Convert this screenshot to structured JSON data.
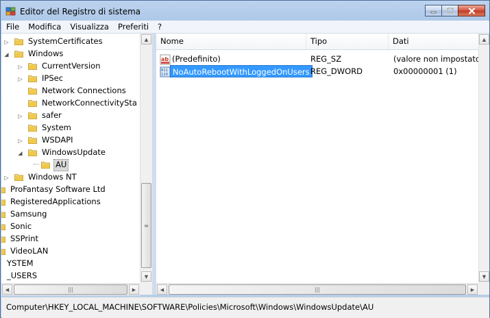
{
  "window": {
    "title": "Editor del Registro di sistema"
  },
  "menu": [
    "File",
    "Modifica",
    "Visualizza",
    "Preferiti",
    "?"
  ],
  "tree": {
    "items": [
      {
        "label": "SystemCertificates",
        "expander": "collapsed"
      },
      {
        "label": "Windows",
        "expander": "expanded"
      },
      {
        "label": "CurrentVersion",
        "expander": "collapsed"
      },
      {
        "label": "IPSec",
        "expander": "collapsed"
      },
      {
        "label": "Network Connections",
        "expander": "none"
      },
      {
        "label": "NetworkConnectivitySta",
        "expander": "none"
      },
      {
        "label": "safer",
        "expander": "collapsed"
      },
      {
        "label": "System",
        "expander": "none"
      },
      {
        "label": "WSDAPI",
        "expander": "collapsed"
      },
      {
        "label": "WindowsUpdate",
        "expander": "expanded"
      },
      {
        "label": "AU",
        "expander": "none",
        "selected": true
      },
      {
        "label": "Windows NT",
        "expander": "collapsed"
      },
      {
        "label": "ProFantasy Software Ltd",
        "expander": "none"
      },
      {
        "label": "RegisteredApplications",
        "expander": "none"
      },
      {
        "label": "Samsung",
        "expander": "none"
      },
      {
        "label": "Sonic",
        "expander": "none"
      },
      {
        "label": "SSPrint",
        "expander": "none"
      },
      {
        "label": "VideoLAN",
        "expander": "none"
      },
      {
        "label": "YSTEM",
        "expander": "none"
      },
      {
        "label": "_USERS",
        "expander": "none"
      }
    ]
  },
  "list": {
    "columns": [
      "Nome",
      "Tipo",
      "Dati"
    ],
    "rows": [
      {
        "icon": "string-value-icon",
        "name": "(Predefinito)",
        "type": "REG_SZ",
        "data": "(valore non impostato)"
      },
      {
        "icon": "dword-value-icon",
        "name": "NoAutoRebootWithLoggedOnUsers",
        "type": "REG_DWORD",
        "data": "0x00000001 (1)",
        "selected": true
      }
    ]
  },
  "status": {
    "path": "Computer\\HKEY_LOCAL_MACHINE\\SOFTWARE\\Policies\\Microsoft\\Windows\\WindowsUpdate\\AU"
  },
  "colors": {
    "selection": "#3399ff",
    "folder": "#e9c45a",
    "window_frame": "#a9c4e6"
  }
}
